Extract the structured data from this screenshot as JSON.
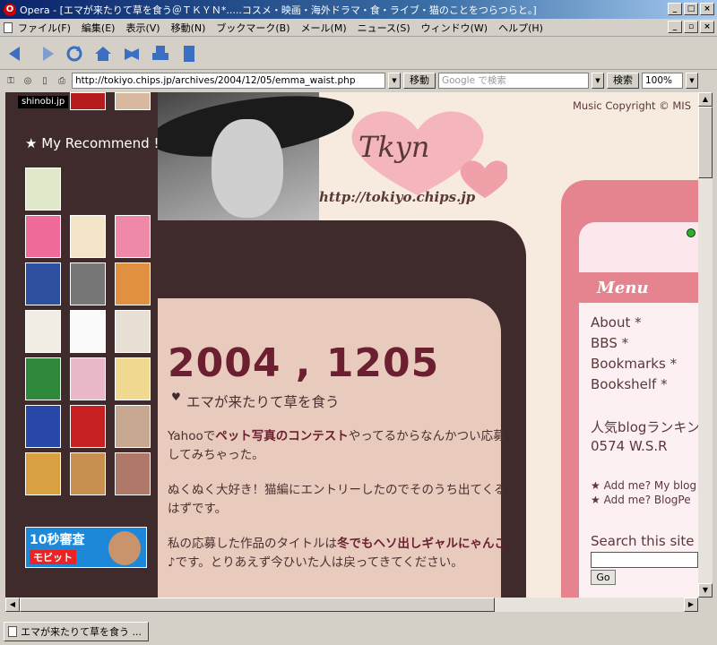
{
  "window": {
    "title": "Opera - [エマが来たりて草を食う＠ＴＫＹＮ*.....コスメ・映画・海外ドラマ・食・ライブ・猫のことをつらつらと。]"
  },
  "menubar": {
    "items": [
      "ファイル(F)",
      "編集(E)",
      "表示(V)",
      "移動(N)",
      "ブックマーク(B)",
      "メール(M)",
      "ニュース(S)",
      "ウィンドウ(W)",
      "ヘルプ(H)"
    ]
  },
  "addressbar": {
    "url": "http://tokiyo.chips.jp/archives/2004/12/05/emma_waist.php",
    "go_label": "移動",
    "search_placeholder": "Google で検索",
    "search_label": "検索",
    "zoom": "100%"
  },
  "statusbar": {
    "tab_label": "エマが来たりて草を食う ..."
  },
  "page": {
    "shinobi": "shinobi.jp",
    "recommend": "★ My Recommend !",
    "site_name": "Tkyn",
    "site_url": "http://tokiyo.chips.jp",
    "copyright": "Music Copyright © MIS",
    "date": "2004 , 1205",
    "entry_title": "エマが来たりて草を食う",
    "paragraphs": [
      [
        "Yahooで",
        "ペット写真のコンテスト",
        "やってるからなんかつい応募してみちゃった。"
      ],
      [
        "ぬくぬく大好き！猫編にエントリーしたのでそのうち出てくるはずです。"
      ],
      [
        "私の応募した作品のタイトルは",
        "冬でもヘソ出しギャルにゃんこ♪",
        "です。とりあえず今ひいた人は戻ってきてください。"
      ]
    ],
    "ad": {
      "line1": "10秒審査",
      "line2": "モビット"
    },
    "menu_title": "Menu",
    "menu_links": [
      "About *",
      "BBS *",
      "Bookmarks *",
      "Bookshelf *"
    ],
    "ranking_lines": [
      "人気blogランキン",
      "0574 W.S.R"
    ],
    "add_me": [
      "★ Add me? My blog",
      "★ Add me? BlogPe"
    ],
    "search_title": "Search this site",
    "search_go": "Go"
  },
  "colors": {
    "dark_brown": "#3f2b2c",
    "date_red": "#6b1f30",
    "pink": "#e5848f",
    "cream": "#f7ebe0"
  }
}
